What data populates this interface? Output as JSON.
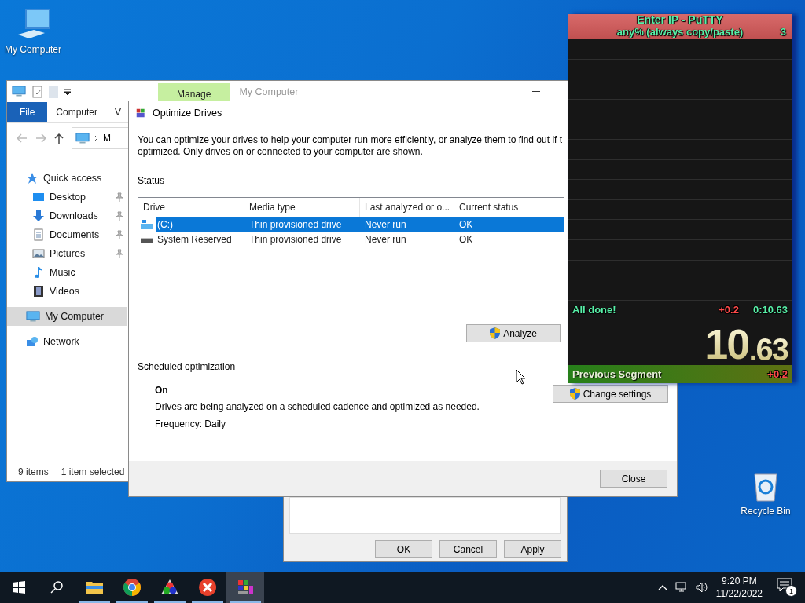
{
  "desktop_icons": [
    {
      "kind": "computer",
      "label": "My Computer"
    },
    {
      "kind": "recycle",
      "label": "Recycle Bin"
    }
  ],
  "explorer": {
    "context_tab": "Manage",
    "title": "My Computer",
    "ribbon_tabs": [
      {
        "label": "File",
        "kind": "file"
      },
      {
        "label": "Computer",
        "kind": "tab"
      },
      {
        "label": "V",
        "kind": "tab"
      }
    ],
    "address": "M",
    "nav": [
      {
        "label": "Quick access",
        "kind": "star",
        "selected": false,
        "children": [
          {
            "label": "Desktop",
            "kind": "desktop",
            "pinned": true,
            "selected": false
          },
          {
            "label": "Downloads",
            "kind": "downloads",
            "pinned": true,
            "selected": false
          },
          {
            "label": "Documents",
            "kind": "documents",
            "pinned": true,
            "selected": false
          },
          {
            "label": "Pictures",
            "kind": "pictures",
            "pinned": true,
            "selected": false
          },
          {
            "label": "Music",
            "kind": "music",
            "pinned": false,
            "selected": false
          },
          {
            "label": "Videos",
            "kind": "videos",
            "pinned": false,
            "selected": false
          }
        ]
      },
      {
        "label": "My Computer",
        "kind": "computer",
        "selected": true
      },
      {
        "label": "Network",
        "kind": "network",
        "selected": false
      }
    ],
    "status_bar": [
      "9 items",
      "1 item selected"
    ]
  },
  "properties_dialog": {
    "buttons": [
      "OK",
      "Cancel",
      "Apply"
    ]
  },
  "optimize_drives": {
    "title": "Optimize Drives",
    "description_lines": [
      "You can optimize your drives to help your computer run more efficiently, or analyze them to find out if t",
      "optimized. Only drives on or connected to your computer are shown."
    ],
    "status_heading": "Status",
    "columns": [
      "Drive",
      "Media type",
      "Last analyzed or o...",
      "Current status"
    ],
    "drives": [
      {
        "kind": "system",
        "drive": "(C:)",
        "media_type": "Thin provisioned drive",
        "last_analyzed": "Never run",
        "current_status": "OK",
        "selected": true
      },
      {
        "kind": "reserved",
        "drive": "System Reserved",
        "media_type": "Thin provisioned drive",
        "last_analyzed": "Never run",
        "current_status": "OK",
        "selected": false
      }
    ],
    "analyze_button": "Analyze",
    "scheduled": {
      "heading": "Scheduled optimization",
      "state": "On",
      "description": "Drives are being analyzed on a scheduled cadence and optimized as needed.",
      "frequency": "Frequency: Daily",
      "button": "Change settings"
    },
    "close_button": "Close"
  },
  "splits": {
    "game": "Enter IP - PuTTY",
    "category": "any% (always copy/paste)",
    "attempts": "3",
    "summary": {
      "label": "All done!",
      "delta": "+0.2",
      "time": "0:10.63"
    },
    "timer": {
      "main": "10",
      "fraction": ".63"
    },
    "previous": {
      "label": "Previous Segment",
      "value": "+0.2"
    }
  },
  "taskbar": {
    "apps": [
      {
        "kind": "explorer",
        "active": false
      },
      {
        "kind": "chrome",
        "active": false
      },
      {
        "kind": "circles",
        "active": false
      },
      {
        "kind": "red-x",
        "active": false
      },
      {
        "kind": "defrag",
        "active": true
      }
    ],
    "time": "9:20 PM",
    "date": "11/22/2022",
    "notifications": "1"
  }
}
